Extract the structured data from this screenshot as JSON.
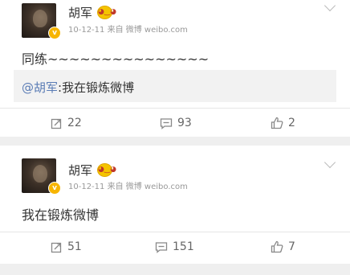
{
  "posts": [
    {
      "username": "胡军",
      "meta": "10-12-11  来自 微博 weibo.com",
      "text": "同练~~~~~~~~~~~~~~~",
      "quote": {
        "mention": "@胡军",
        "text": ":我在锻炼微博"
      },
      "repost_count": "22",
      "comment_count": "93",
      "like_count": "2"
    },
    {
      "username": "胡军",
      "meta": "10-12-11  来自 微博 weibo.com",
      "text": "我在锻炼微博",
      "repost_count": "51",
      "comment_count": "151",
      "like_count": "7"
    }
  ],
  "icons": {
    "repost": "repost-icon",
    "comment": "comment-icon",
    "like": "like-icon",
    "verified": "verified-badge-icon",
    "options": "chevron-down-icon"
  },
  "colors": {
    "mention": "#5a7cb5",
    "verified_badge": "#f7b500",
    "background": "#efefef"
  }
}
